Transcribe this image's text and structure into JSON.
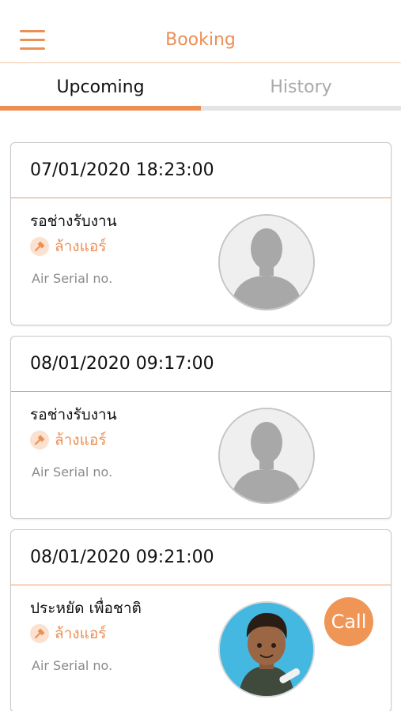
{
  "header": {
    "title": "Booking",
    "menu_icon": "hamburger-icon"
  },
  "tabs": [
    {
      "label": "Upcoming",
      "active": true
    },
    {
      "label": "History",
      "active": false
    }
  ],
  "colors": {
    "accent": "#ec8f55",
    "inactive_tab": "#a9a9a9",
    "divider": "#ef9a62"
  },
  "bookings": [
    {
      "datetime": "07/01/2020 18:23:00",
      "status": "รอช่างรับงาน",
      "service_icon": "service-tool-icon",
      "service": "ล้างแอร์",
      "serial_label": "Air Serial no.",
      "avatar": "placeholder-avatar"
    },
    {
      "datetime": "08/01/2020 09:17:00",
      "status": "รอช่างรับงาน",
      "service_icon": "service-tool-icon",
      "service": "ล้างแอร์",
      "serial_label": "Air Serial no.",
      "avatar": "placeholder-avatar"
    },
    {
      "datetime": "08/01/2020 09:21:00",
      "status": "ประหยัด เพื่อชาติ",
      "service_icon": "service-tool-icon",
      "service": "ล้างแอร์",
      "serial_label": "Air Serial no.",
      "avatar": "technician-avatar",
      "call_label": "Call"
    }
  ]
}
